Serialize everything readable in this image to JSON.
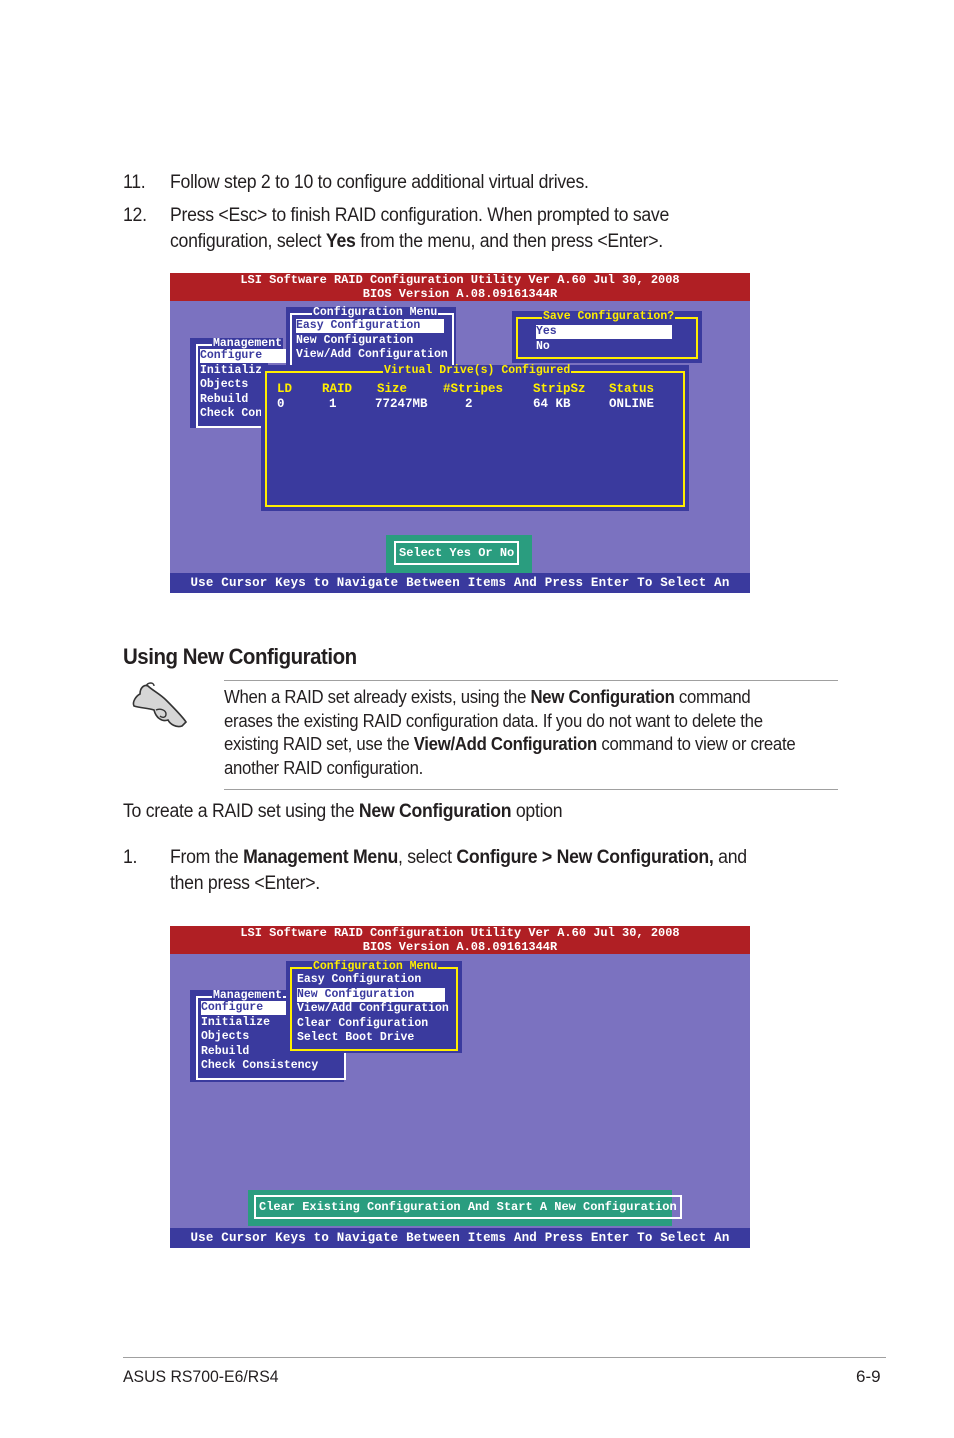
{
  "steps_top": [
    {
      "number": "11.",
      "lines": [
        [
          {
            "t": "Follow step 2 to 10 to configure additional virtual drives.",
            "b": false
          }
        ]
      ]
    },
    {
      "number": "12.",
      "lines": [
        [
          {
            "t": "Press <Esc> to finish RAID configuration. When prompted to save",
            "b": false
          }
        ],
        [
          {
            "t": "configuration, select ",
            "b": false
          },
          {
            "t": "Yes",
            "b": true
          },
          {
            "t": " from the menu, and then press <Enter>.",
            "b": false
          }
        ]
      ]
    }
  ],
  "screen1": {
    "title_line1": "LSI Software RAID Configuration Utility Ver A.60 Jul 30, 2008",
    "title_line2": "BIOS Version   A.08.09161344R",
    "management": {
      "caption": "Management",
      "items": [
        "Configure",
        "Initializ",
        "Objects",
        "Rebuild",
        "Check Con"
      ],
      "selected": 0
    },
    "config_menu": {
      "caption": "Configuration Menu",
      "items": [
        "Easy Configuration",
        "New Configuration",
        "View/Add Configuration"
      ],
      "selected": 0
    },
    "save_dialog": {
      "caption": "Save Configuration?",
      "items": [
        "Yes",
        "No"
      ],
      "selected": 0
    },
    "virtual_drives": {
      "caption": "Virtual Drive(s) Configured",
      "columns": [
        "LD",
        "RAID",
        "Size",
        "#Stripes",
        "StripSz",
        "Status"
      ],
      "rows": [
        [
          "0",
          "1",
          "77247MB",
          "2",
          "64 KB",
          "ONLINE"
        ]
      ]
    },
    "hint": "Select Yes Or No",
    "footer": "Use Cursor Keys to Navigate Between Items And Press Enter To Select An Option"
  },
  "section_heading": "Using New Configuration",
  "note": {
    "icon": "pointing-hand-icon",
    "lines": [
      [
        {
          "t": "When a RAID set already exists, using the ",
          "b": false
        },
        {
          "t": "New Configuration",
          "b": true
        },
        {
          "t": " command",
          "b": false
        }
      ],
      [
        {
          "t": "erases the existing RAID configuration data. If you do not want to delete the",
          "b": false
        }
      ],
      [
        {
          "t": "existing RAID set, use the ",
          "b": false
        },
        {
          "t": "View/Add Configuration",
          "b": true
        },
        {
          "t": " command to view or create",
          "b": false
        }
      ],
      [
        {
          "t": "another RAID configuration.",
          "b": false
        }
      ]
    ]
  },
  "intro_line": [
    {
      "t": "To create a RAID set using the ",
      "b": false
    },
    {
      "t": "New Configuration",
      "b": true
    },
    {
      "t": " option",
      "b": false
    }
  ],
  "steps_bottom": [
    {
      "number": "1.",
      "lines": [
        [
          {
            "t": "From the ",
            "b": false
          },
          {
            "t": "Management Menu",
            "b": true
          },
          {
            "t": ", select ",
            "b": false
          },
          {
            "t": "Configure > New Configuration,",
            "b": true
          },
          {
            "t": " and",
            "b": false
          }
        ],
        [
          {
            "t": "then press <Enter>.",
            "b": false
          }
        ]
      ]
    }
  ],
  "screen2": {
    "title_line1": "LSI Software RAID Configuration Utility Ver A.60 Jul 30, 2008",
    "title_line2": "BIOS Version   A.08.09161344R",
    "management": {
      "caption": "Management",
      "items": [
        "Configure",
        "Initialize",
        "Objects",
        "Rebuild",
        "Check Consistency"
      ],
      "selected": 0
    },
    "config_menu": {
      "caption": "Configuration Menu",
      "items": [
        "Easy Configuration",
        "New Configuration",
        "View/Add Configuration",
        "Clear Configuration",
        "Select Boot Drive"
      ],
      "selected": 1
    },
    "hint": "Clear Existing Configuration And Start A New Configuration",
    "footer": "Use Cursor Keys to Navigate Between Items And Press Enter To Select An Option"
  },
  "page_footer": {
    "left": "ASUS RS700-E6/RS4",
    "right": "6-9"
  },
  "colors": {
    "title_bar": "#b01f24",
    "screen_bg": "#7b72c0",
    "panel_bg": "#3a3a9e",
    "accent_yellow": "#ffee00",
    "hint_bg": "#2a9d7f"
  }
}
